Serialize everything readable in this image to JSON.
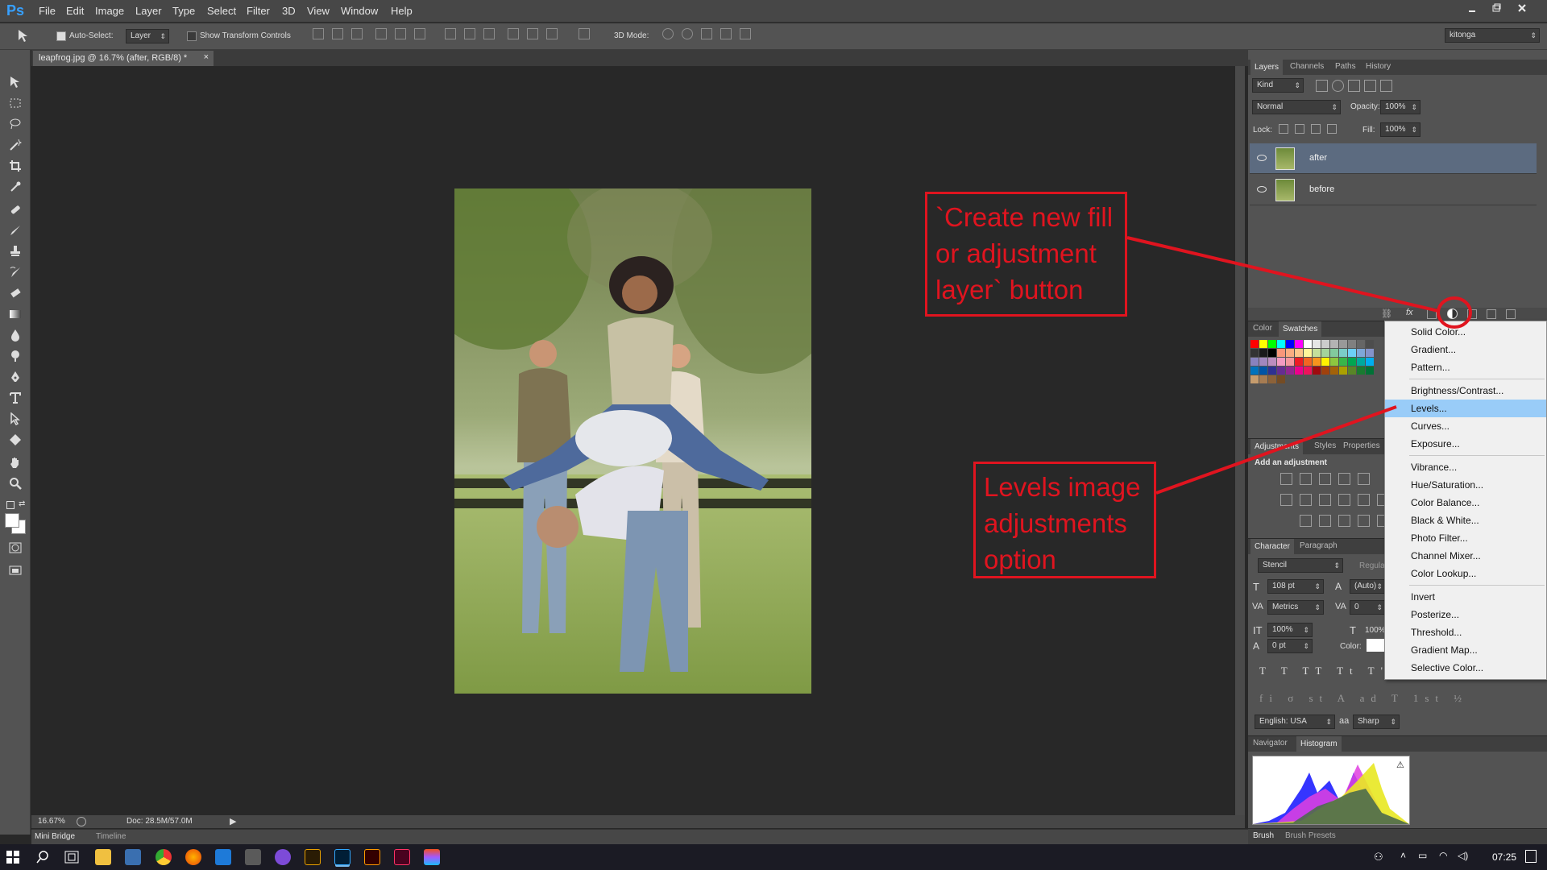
{
  "app": {
    "logo": "Ps",
    "menu": [
      "File",
      "Edit",
      "Image",
      "Layer",
      "Type",
      "Select",
      "Filter",
      "3D",
      "View",
      "Window",
      "Help"
    ]
  },
  "options_bar": {
    "auto_select_label": "Auto-Select:",
    "auto_select_value": "Layer",
    "show_transform_label": "Show Transform Controls",
    "mode3d_label": "3D Mode:",
    "workspace": "kitonga"
  },
  "document": {
    "tab_title": "leapfrog.jpg @ 16.7% (after, RGB/8) *",
    "zoom": "16.67%",
    "doc_info": "Doc: 28.5M/57.0M"
  },
  "bottom_tabs": [
    "Mini Bridge",
    "Timeline"
  ],
  "layers_panel": {
    "tabs": [
      "Layers",
      "Channels",
      "Paths",
      "History"
    ],
    "filter_kind": "Kind",
    "blend_mode": "Normal",
    "opacity_label": "Opacity:",
    "opacity_value": "100%",
    "lock_label": "Lock:",
    "fill_label": "Fill:",
    "fill_value": "100%",
    "layers": [
      {
        "name": "after",
        "selected": true
      },
      {
        "name": "before",
        "selected": false
      }
    ]
  },
  "color_panel": {
    "tabs": [
      "Color",
      "Swatches"
    ]
  },
  "adjustments_panel": {
    "tabs": [
      "Adjustments",
      "Styles",
      "Properties"
    ],
    "heading": "Add an adjustment"
  },
  "character_panel": {
    "tabs": [
      "Character",
      "Paragraph"
    ],
    "font": "Stencil",
    "style": "Regular",
    "size": "108 pt",
    "leading": "(Auto)",
    "kerning": "Metrics",
    "tracking": "0",
    "vscale": "100%",
    "hscale": "100%",
    "baseline": "0 pt",
    "color_label": "Color:",
    "language": "English: USA",
    "antialias": "Sharp"
  },
  "navigator_panel": {
    "tabs": [
      "Navigator",
      "Histogram"
    ]
  },
  "brush_panel": {
    "tabs": [
      "Brush",
      "Brush Presets"
    ]
  },
  "context_menu": {
    "groups": [
      [
        "Solid Color...",
        "Gradient...",
        "Pattern..."
      ],
      [
        "Brightness/Contrast...",
        "Levels...",
        "Curves...",
        "Exposure..."
      ],
      [
        "Vibrance...",
        "Hue/Saturation...",
        "Color Balance...",
        "Black & White...",
        "Photo Filter...",
        "Channel Mixer...",
        "Color Lookup..."
      ],
      [
        "Invert",
        "Posterize...",
        "Threshold...",
        "Gradient Map...",
        "Selective Color..."
      ]
    ],
    "highlighted": "Levels..."
  },
  "annotations": {
    "create_button": "`Create new fill or adjustment layer` button",
    "levels_option": "Levels image adjustments option"
  },
  "taskbar": {
    "time": "07:25"
  },
  "colors": {
    "annotation": "#e0141f",
    "menu_highlight": "#99ccf8",
    "selected_layer": "#5c6b80",
    "panel": "#535353",
    "canvas": "#282828"
  }
}
